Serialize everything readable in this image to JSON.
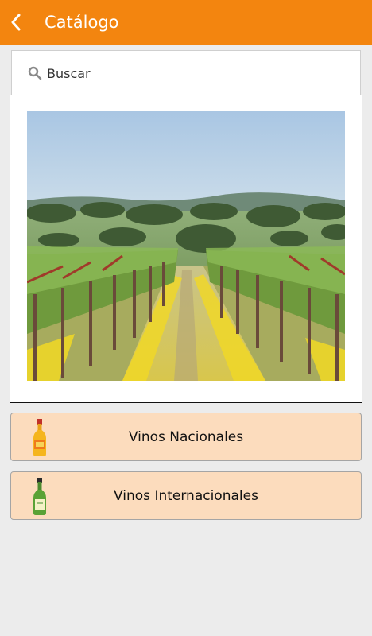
{
  "appbar": {
    "title": "Catálogo",
    "back_icon": "chevron-left-icon",
    "color": "#f3850f"
  },
  "search": {
    "label": "Buscar",
    "icon": "search-icon"
  },
  "banner": {
    "image": "vineyard-photo"
  },
  "categories": [
    {
      "label": "Vinos Nacionales",
      "icon": "yellow-bottle-icon"
    },
    {
      "label": "Vinos Internacionales",
      "icon": "green-bottle-icon"
    }
  ],
  "colors": {
    "category_background": "#fcdcbd",
    "page_background": "#ececec"
  }
}
